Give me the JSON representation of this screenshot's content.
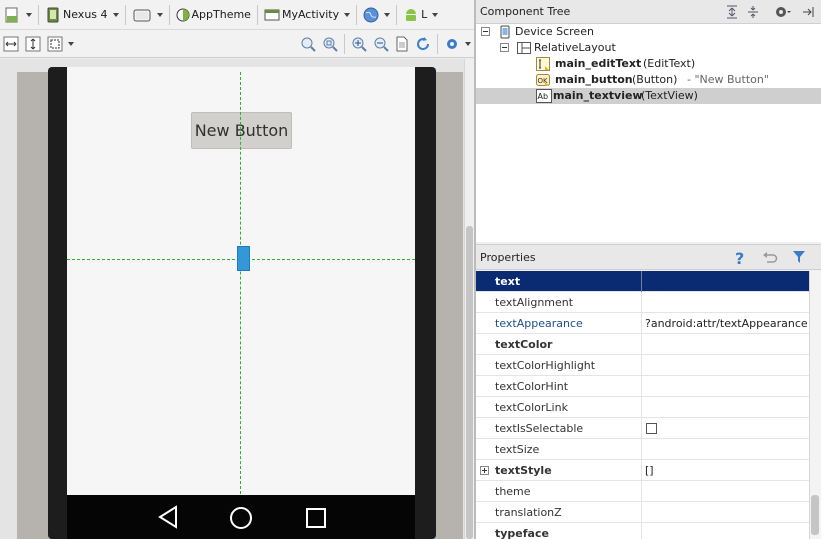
{
  "toolbar": {
    "device": "Nexus 4",
    "theme": "AppTheme",
    "activity": "MyActivity",
    "api": "L"
  },
  "preview": {
    "button_text": "New Button"
  },
  "component_tree": {
    "title": "Component Tree",
    "items": [
      {
        "name": "Device Screen",
        "type": "",
        "extra": ""
      },
      {
        "name": "RelativeLayout",
        "type": "",
        "extra": ""
      },
      {
        "name": "main_editText",
        "type": "(EditText)",
        "extra": ""
      },
      {
        "name": "main_button",
        "type": "(Button)",
        "extra": "- \"New Button\""
      },
      {
        "name": "main_textview",
        "type": "(TextView)",
        "extra": ""
      }
    ]
  },
  "properties": {
    "title": "Properties",
    "rows": [
      {
        "name": "text",
        "value": ""
      },
      {
        "name": "textAlignment",
        "value": ""
      },
      {
        "name": "textAppearance",
        "value": "?android:attr/textAppearanceMed"
      },
      {
        "name": "textColor",
        "value": ""
      },
      {
        "name": "textColorHighlight",
        "value": ""
      },
      {
        "name": "textColorHint",
        "value": ""
      },
      {
        "name": "textColorLink",
        "value": ""
      },
      {
        "name": "textIsSelectable",
        "value": ""
      },
      {
        "name": "textSize",
        "value": ""
      },
      {
        "name": "textStyle",
        "value": "[]"
      },
      {
        "name": "theme",
        "value": ""
      },
      {
        "name": "translationZ",
        "value": ""
      },
      {
        "name": "typeface",
        "value": ""
      }
    ]
  },
  "colors": {
    "accent": "#0a2b72",
    "guide": "#2db12d",
    "selection": "#3397d8"
  }
}
